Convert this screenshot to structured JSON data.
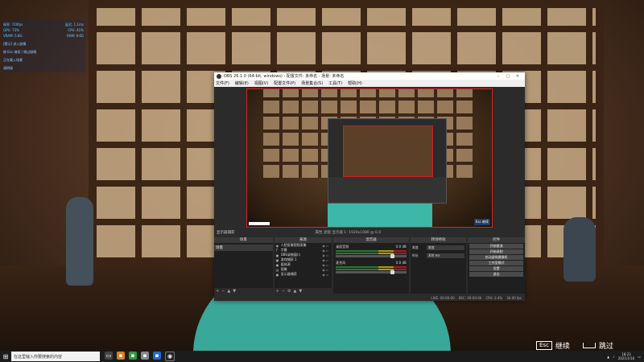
{
  "stats": {
    "rows": [
      [
        "帧率: 720fps",
        "延迟: 1.1ms"
      ],
      [
        "GPU: 73%",
        "CPU: 41%"
      ],
      [
        "VRAM: 5.8G",
        "RAM: 9.6G"
      ]
    ],
    "messages": [
      "[提示] 进入剧情",
      "按 Esc 继续 / 跳过剧情",
      "正在载入场景",
      "请稍候"
    ]
  },
  "obs": {
    "title": "OBS 26.1.0 (64-bit, windows) - 配置文件: 未命名 - 场景: 未命名",
    "menu": [
      "文件(F)",
      "编辑(E)",
      "视图(V)",
      "配置文件(P)",
      "场景集合(S)",
      "工具(T)",
      "帮助(H)"
    ],
    "window_buttons": [
      "–",
      "□",
      "✕"
    ],
    "preview_badge": "Esc 继续",
    "scene_bar_left": "显示器捕获",
    "scene_bar_mid": "属性   滤镜   显示器  1: 1920x1080 @ 0,0",
    "docks": {
      "scenes": {
        "header": "场景",
        "items": [
          "场景"
        ]
      },
      "sources": {
        "header": "来源",
        "items": [
          {
            "icon": "◉",
            "name": "人脸抠像视频采集"
          },
          {
            "icon": "T",
            "name": "字幕"
          },
          {
            "icon": "▣",
            "name": "OBS录制窗口"
          },
          {
            "icon": "▣",
            "name": "游戏捕获 1"
          },
          {
            "icon": "▣",
            "name": "媒体源"
          },
          {
            "icon": "▤",
            "name": "图像"
          },
          {
            "icon": "▣",
            "name": "显示器捕获"
          }
        ]
      },
      "mixer": {
        "header": "混音器",
        "channels": [
          {
            "name": "桌面音频",
            "db": "0.0 dB"
          },
          {
            "name": "麦克风",
            "db": "0.0 dB"
          }
        ]
      },
      "transitions": {
        "header": "转场特效",
        "rows": [
          {
            "k": "渐变",
            "v": "渐变"
          },
          {
            "k": "时长",
            "v": "300 ms"
          }
        ]
      },
      "controls": {
        "header": "控件",
        "buttons": [
          "开始推流",
          "开始录制",
          "启动虚拟摄像机",
          "工作室模式",
          "设置",
          "退出"
        ]
      }
    },
    "status": [
      "LIVE: 00:00:00",
      "REC: 00:00:00",
      "CPU: 2.4%",
      "30.00 fps"
    ]
  },
  "taskbar": {
    "search_placeholder": "在这里输入你要搜索的内容",
    "time": "18:23",
    "date": "2021/1/16"
  },
  "hints": {
    "continue_key": "Esc",
    "continue_label": "继续",
    "skip_label": "跳过"
  }
}
